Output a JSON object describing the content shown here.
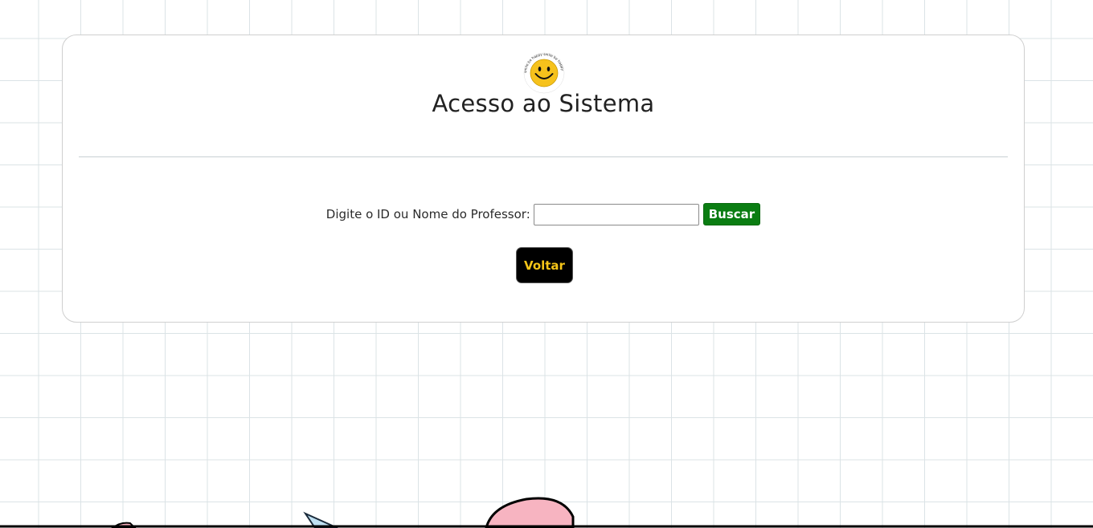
{
  "login": {
    "title": "Acesso ao Sistema",
    "logo_icon": "smiley-face-icon",
    "logo_badge_text": "smile be happy smile be happy"
  },
  "search": {
    "label": "Digite o ID ou Nome do Professor:",
    "input_value": "",
    "input_placeholder": "",
    "button_label": "Buscar",
    "button_color": "#0a7d12"
  },
  "back_button": {
    "label": "Voltar",
    "background": "#000000",
    "text_color": "#f5c518"
  },
  "background": {
    "pattern": "grid-paper",
    "grid_color": "#dbe3e6",
    "decoration_icons": [
      "bird-head-icon",
      "bird-beak-icon",
      "pink-cloud-icon"
    ]
  }
}
